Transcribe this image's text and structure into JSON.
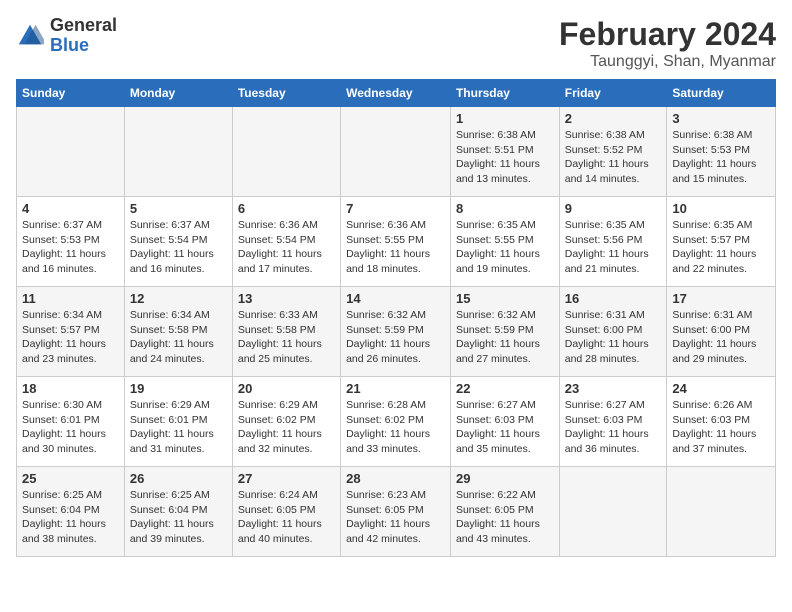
{
  "header": {
    "logo_line1": "General",
    "logo_line2": "Blue",
    "month_year": "February 2024",
    "location": "Taunggyi, Shan, Myanmar"
  },
  "weekdays": [
    "Sunday",
    "Monday",
    "Tuesday",
    "Wednesday",
    "Thursday",
    "Friday",
    "Saturday"
  ],
  "weeks": [
    [
      {
        "day": "",
        "info": ""
      },
      {
        "day": "",
        "info": ""
      },
      {
        "day": "",
        "info": ""
      },
      {
        "day": "",
        "info": ""
      },
      {
        "day": "1",
        "info": "Sunrise: 6:38 AM\nSunset: 5:51 PM\nDaylight: 11 hours and 13 minutes."
      },
      {
        "day": "2",
        "info": "Sunrise: 6:38 AM\nSunset: 5:52 PM\nDaylight: 11 hours and 14 minutes."
      },
      {
        "day": "3",
        "info": "Sunrise: 6:38 AM\nSunset: 5:53 PM\nDaylight: 11 hours and 15 minutes."
      }
    ],
    [
      {
        "day": "4",
        "info": "Sunrise: 6:37 AM\nSunset: 5:53 PM\nDaylight: 11 hours and 16 minutes."
      },
      {
        "day": "5",
        "info": "Sunrise: 6:37 AM\nSunset: 5:54 PM\nDaylight: 11 hours and 16 minutes."
      },
      {
        "day": "6",
        "info": "Sunrise: 6:36 AM\nSunset: 5:54 PM\nDaylight: 11 hours and 17 minutes."
      },
      {
        "day": "7",
        "info": "Sunrise: 6:36 AM\nSunset: 5:55 PM\nDaylight: 11 hours and 18 minutes."
      },
      {
        "day": "8",
        "info": "Sunrise: 6:35 AM\nSunset: 5:55 PM\nDaylight: 11 hours and 19 minutes."
      },
      {
        "day": "9",
        "info": "Sunrise: 6:35 AM\nSunset: 5:56 PM\nDaylight: 11 hours and 21 minutes."
      },
      {
        "day": "10",
        "info": "Sunrise: 6:35 AM\nSunset: 5:57 PM\nDaylight: 11 hours and 22 minutes."
      }
    ],
    [
      {
        "day": "11",
        "info": "Sunrise: 6:34 AM\nSunset: 5:57 PM\nDaylight: 11 hours and 23 minutes."
      },
      {
        "day": "12",
        "info": "Sunrise: 6:34 AM\nSunset: 5:58 PM\nDaylight: 11 hours and 24 minutes."
      },
      {
        "day": "13",
        "info": "Sunrise: 6:33 AM\nSunset: 5:58 PM\nDaylight: 11 hours and 25 minutes."
      },
      {
        "day": "14",
        "info": "Sunrise: 6:32 AM\nSunset: 5:59 PM\nDaylight: 11 hours and 26 minutes."
      },
      {
        "day": "15",
        "info": "Sunrise: 6:32 AM\nSunset: 5:59 PM\nDaylight: 11 hours and 27 minutes."
      },
      {
        "day": "16",
        "info": "Sunrise: 6:31 AM\nSunset: 6:00 PM\nDaylight: 11 hours and 28 minutes."
      },
      {
        "day": "17",
        "info": "Sunrise: 6:31 AM\nSunset: 6:00 PM\nDaylight: 11 hours and 29 minutes."
      }
    ],
    [
      {
        "day": "18",
        "info": "Sunrise: 6:30 AM\nSunset: 6:01 PM\nDaylight: 11 hours and 30 minutes."
      },
      {
        "day": "19",
        "info": "Sunrise: 6:29 AM\nSunset: 6:01 PM\nDaylight: 11 hours and 31 minutes."
      },
      {
        "day": "20",
        "info": "Sunrise: 6:29 AM\nSunset: 6:02 PM\nDaylight: 11 hours and 32 minutes."
      },
      {
        "day": "21",
        "info": "Sunrise: 6:28 AM\nSunset: 6:02 PM\nDaylight: 11 hours and 33 minutes."
      },
      {
        "day": "22",
        "info": "Sunrise: 6:27 AM\nSunset: 6:03 PM\nDaylight: 11 hours and 35 minutes."
      },
      {
        "day": "23",
        "info": "Sunrise: 6:27 AM\nSunset: 6:03 PM\nDaylight: 11 hours and 36 minutes."
      },
      {
        "day": "24",
        "info": "Sunrise: 6:26 AM\nSunset: 6:03 PM\nDaylight: 11 hours and 37 minutes."
      }
    ],
    [
      {
        "day": "25",
        "info": "Sunrise: 6:25 AM\nSunset: 6:04 PM\nDaylight: 11 hours and 38 minutes."
      },
      {
        "day": "26",
        "info": "Sunrise: 6:25 AM\nSunset: 6:04 PM\nDaylight: 11 hours and 39 minutes."
      },
      {
        "day": "27",
        "info": "Sunrise: 6:24 AM\nSunset: 6:05 PM\nDaylight: 11 hours and 40 minutes."
      },
      {
        "day": "28",
        "info": "Sunrise: 6:23 AM\nSunset: 6:05 PM\nDaylight: 11 hours and 42 minutes."
      },
      {
        "day": "29",
        "info": "Sunrise: 6:22 AM\nSunset: 6:05 PM\nDaylight: 11 hours and 43 minutes."
      },
      {
        "day": "",
        "info": ""
      },
      {
        "day": "",
        "info": ""
      }
    ]
  ]
}
